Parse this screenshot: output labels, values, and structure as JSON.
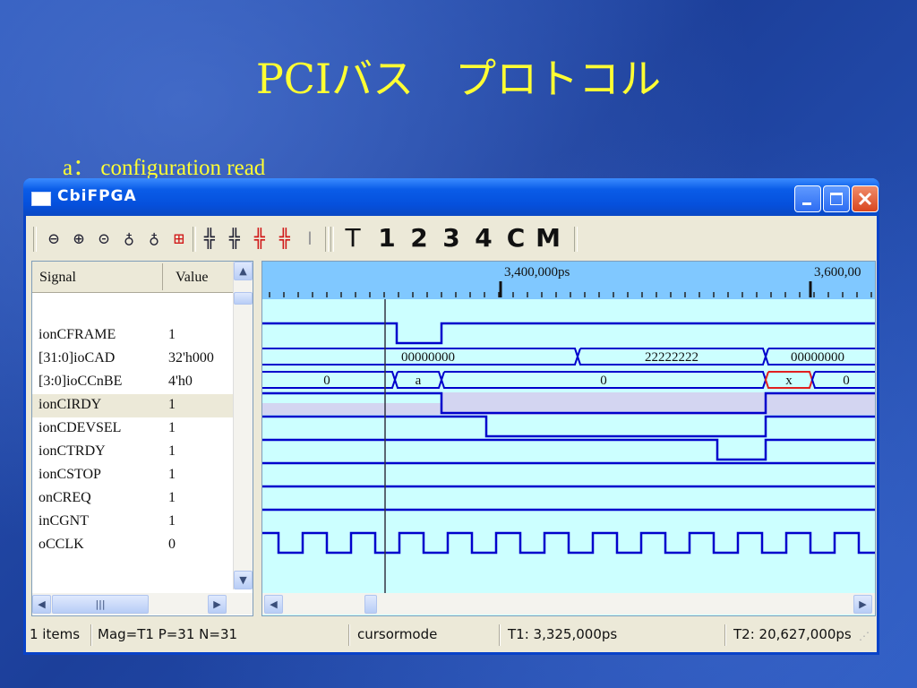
{
  "slide": {
    "title": "PCIバス　プロトコル",
    "subtitle": "a：  configuration read"
  },
  "window": {
    "title": "CbiFPGA",
    "buttons": [
      "minimize",
      "maximize",
      "close"
    ]
  },
  "toolbar": {
    "icons": [
      "zoom-out-icon",
      "zoom-in-icon",
      "zoom-fit-icon",
      "zoom-in-cursor-icon",
      "zoom-out-cursor-icon",
      "zoom-range-icon",
      "prev-edge-icon",
      "next-edge-icon",
      "prev-edge-red-icon",
      "next-edge-red-icon",
      "marker-disabled-icon"
    ],
    "marker_buttons": [
      "T",
      "1",
      "2",
      "3",
      "4",
      "C",
      "M"
    ]
  },
  "signal_list": {
    "columns": [
      "Signal",
      "Value"
    ],
    "rows": [
      {
        "name": "ionCFRAME",
        "value": "1",
        "selected": false
      },
      {
        "name": "[31:0]ioCAD",
        "value": "32'h000",
        "selected": false
      },
      {
        "name": "[3:0]ioCCnBE",
        "value": "4'h0",
        "selected": false
      },
      {
        "name": "ionCIRDY",
        "value": "1",
        "selected": true
      },
      {
        "name": "ionCDEVSEL",
        "value": "1",
        "selected": false
      },
      {
        "name": "ionCTRDY",
        "value": "1",
        "selected": false
      },
      {
        "name": "ionCSTOP",
        "value": "1",
        "selected": false
      },
      {
        "name": "onCREQ",
        "value": "1",
        "selected": false
      },
      {
        "name": "inCGNT",
        "value": "1",
        "selected": false
      },
      {
        "name": "oCCLK",
        "value": "0",
        "selected": false
      }
    ]
  },
  "waveform": {
    "ruler_labels": [
      "3,400,000ps",
      "3,600,00"
    ],
    "bus_values": {
      "ioCAD": [
        "00000000",
        "22222222",
        "00000000"
      ],
      "ioCCnBE": [
        "0",
        "a",
        "0",
        "x",
        "0"
      ]
    }
  },
  "statusbar": {
    "items": "1 items",
    "mag": "Mag=T1  P=31  N=31",
    "mode": "cursormode",
    "t1": "T1: 3,325,000ps",
    "t2": "T2: 20,627,000ps"
  },
  "colors": {
    "wave_line": "#0000cc",
    "wave_bg": "#ccffff",
    "ruler_bg": "#80c8ff",
    "title_text": "#ffff33",
    "highlight": "#e02020"
  }
}
